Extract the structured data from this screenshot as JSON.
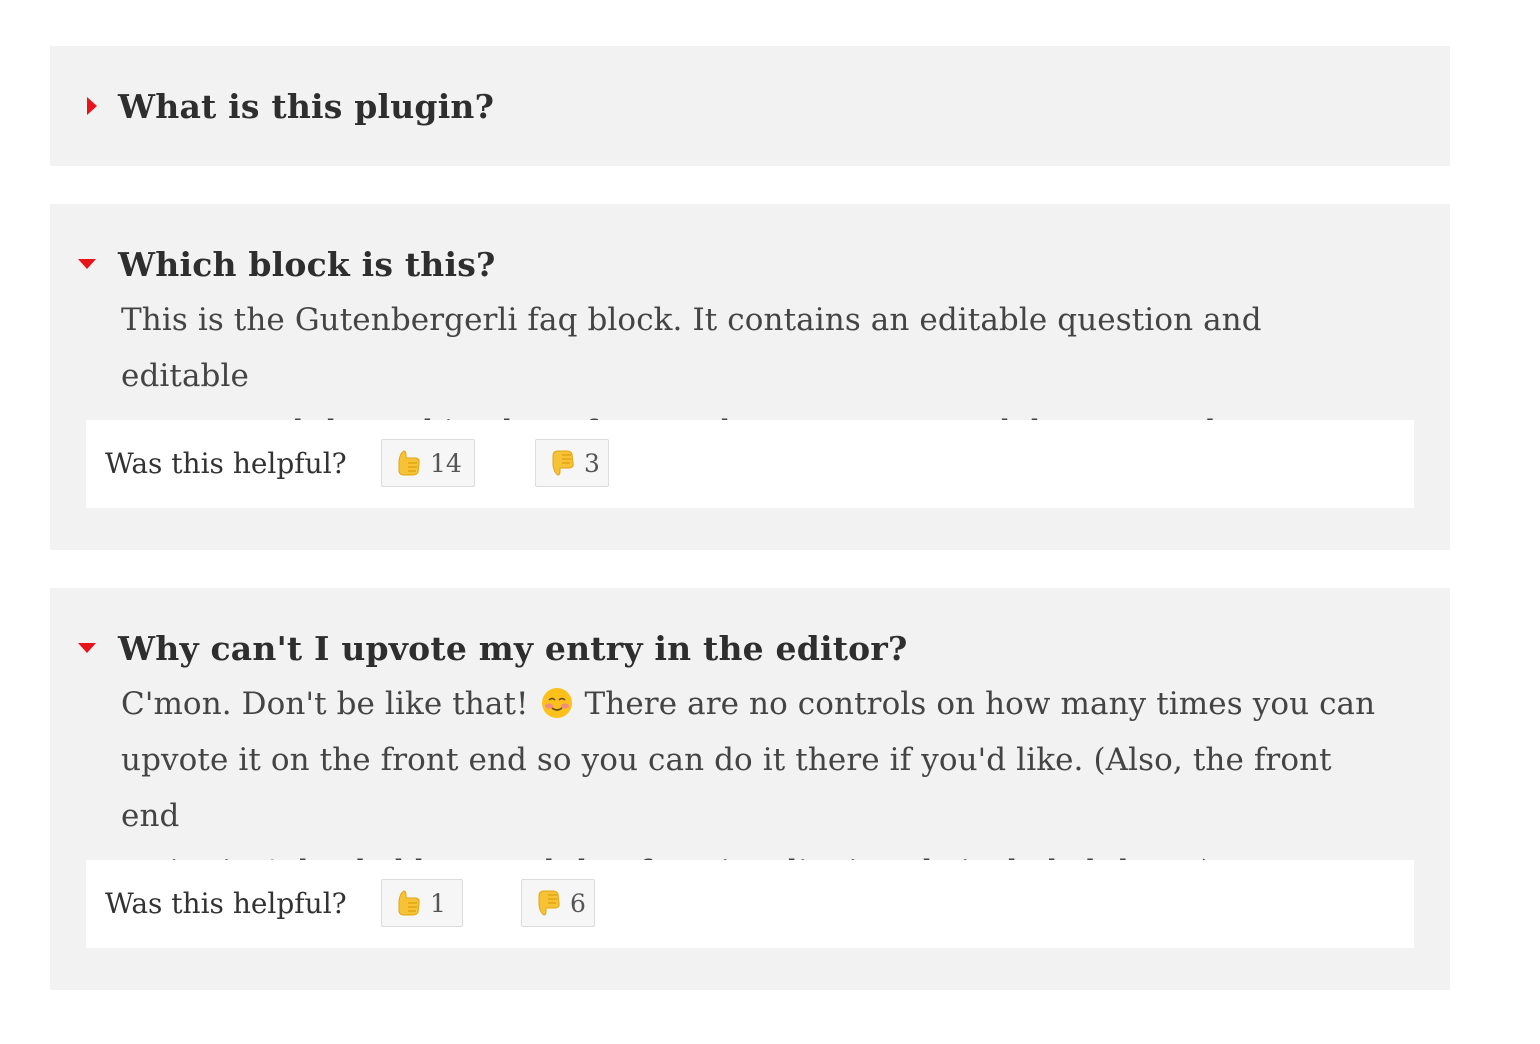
{
  "faqs": [
    {
      "question": "What is this plugin?",
      "expanded": false
    },
    {
      "question": "Which block is this?",
      "expanded": true,
      "answer_lines": [
        "This is the Gutenbergerli faq block. It contains an editable question and editable",
        "answer and then a bit where front end users can up and down vote the entry."
      ],
      "helpful_label": "Was this helpful?",
      "upvotes": "14",
      "downvotes": "3"
    },
    {
      "question": "Why can't I upvote my entry in the editor?",
      "expanded": true,
      "answer_line1_before": "C'mon. Don't be like that!",
      "answer_line1_after": "There are no controls on how many times you can",
      "answer_lines_rest": [
        "upvote it on the front end so you can do it there if you'd like. (Also, the front end",
        "script isn't loaded here and that functionality is only included there.)"
      ],
      "helpful_label": "Was this helpful?",
      "upvotes": "1",
      "downvotes": "6"
    }
  ],
  "colors": {
    "accent": "#e8141c",
    "panel_bg": "#f2f2f2",
    "vote_bar_bg": "#ffffff"
  },
  "icons": {
    "collapsed": "caret-right-icon",
    "expanded": "caret-down-icon",
    "upvote": "thumbs-up-icon",
    "downvote": "thumbs-down-icon",
    "emoji": "smiling-blush-emoji-icon"
  }
}
